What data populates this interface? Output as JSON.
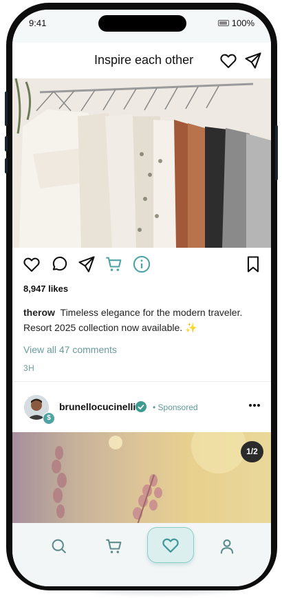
{
  "status_bar": {
    "time": "9:41",
    "battery": "100%"
  },
  "header": {
    "title": "Inspire each other"
  },
  "post1": {
    "likes": "8,947 likes",
    "username": "therow",
    "caption": "Timeless elegance for the modern traveler. Resort 2025 collection now available. ✨",
    "view_comments": "View all 47 comments",
    "age": "3H"
  },
  "post2": {
    "username": "brunellocucinelli",
    "sponsored": "• Sponsored",
    "avatar_badge": "$",
    "image_counter": "1/2"
  },
  "tabbar": {
    "items": [
      "search-icon",
      "cart-icon",
      "heart-icon",
      "user-icon"
    ],
    "active": "heart-icon"
  },
  "colors": {
    "accent": "#4fa3a3",
    "muted_text": "#6a9a9b"
  }
}
